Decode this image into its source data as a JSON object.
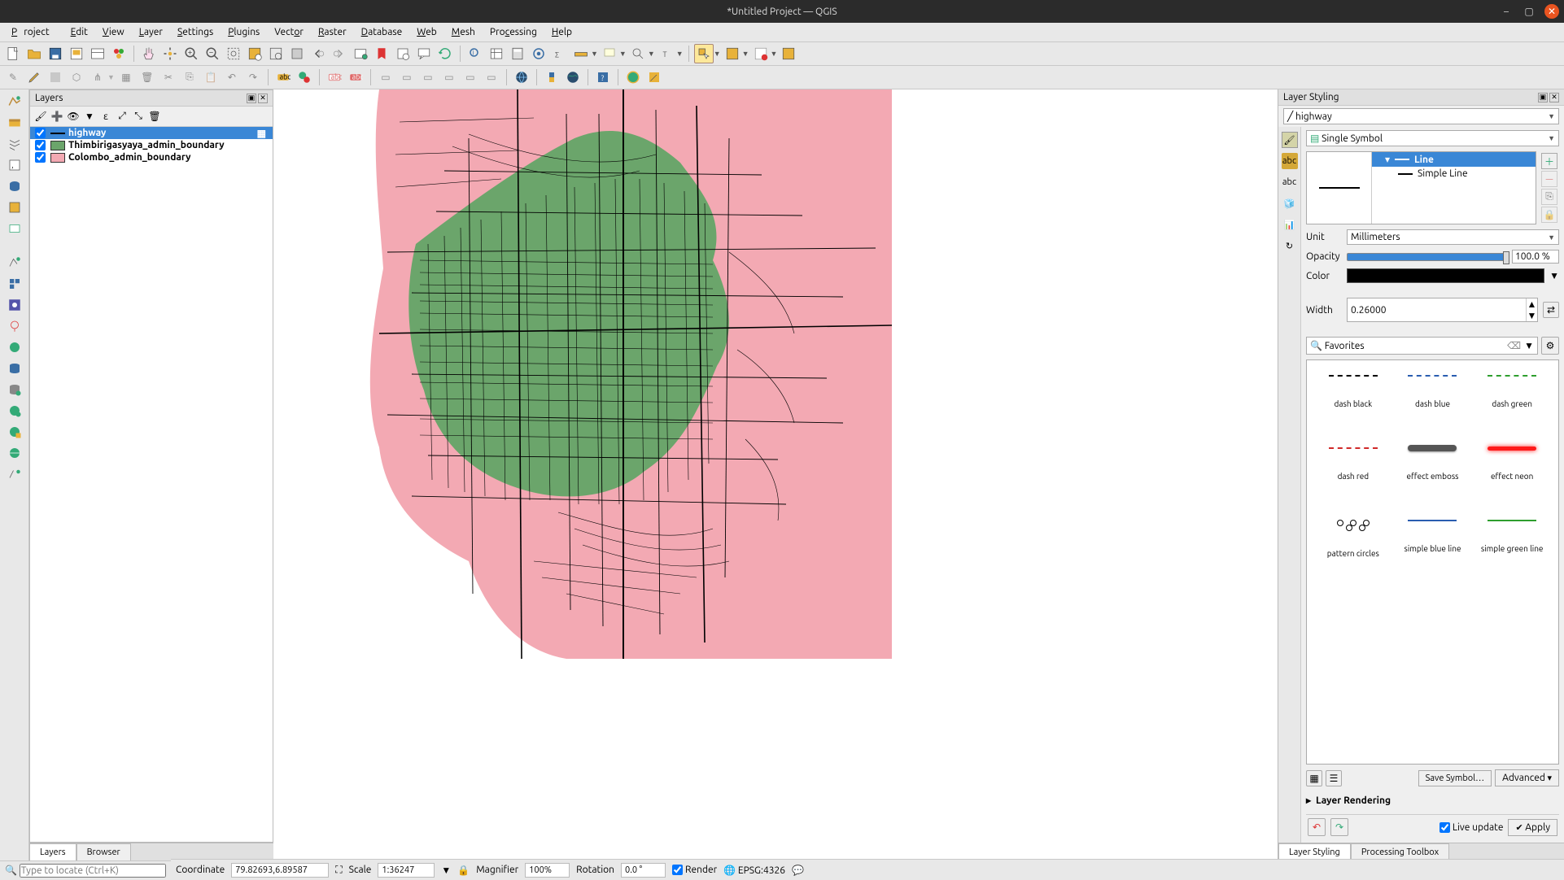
{
  "window": {
    "title": "*Untitled Project — QGIS"
  },
  "menu": [
    "Project",
    "Edit",
    "View",
    "Layer",
    "Settings",
    "Plugins",
    "Vector",
    "Raster",
    "Database",
    "Web",
    "Mesh",
    "Processing",
    "Help"
  ],
  "layers_panel": {
    "title": "Layers",
    "items": [
      {
        "name": "highway",
        "checked": true,
        "selected": true,
        "kind": "line"
      },
      {
        "name": "Thimbirigasyaya_admin_boundary",
        "checked": true,
        "color": "#6ba56b"
      },
      {
        "name": "Colombo_admin_boundary",
        "checked": true,
        "color": "#f3a9b3"
      }
    ],
    "tabs": {
      "layers": "Layers",
      "browser": "Browser"
    }
  },
  "locate_placeholder": "Type to locate (Ctrl+K)",
  "status": {
    "coord_label": "Coordinate",
    "coord": "79.82693,6.89587",
    "scale_label": "Scale",
    "scale": "1:36247",
    "mag_label": "Magnifier",
    "mag": "100%",
    "rot_label": "Rotation",
    "rot": "0.0 °",
    "render": "Render",
    "epsg": "EPSG:4326"
  },
  "styling": {
    "title": "Layer Styling",
    "layer": "highway",
    "renderer": "Single Symbol",
    "tree": {
      "line": "Line",
      "simple": "Simple Line"
    },
    "unit_label": "Unit",
    "unit": "Millimeters",
    "opacity_label": "Opacity",
    "opacity": "100.0 %",
    "color_label": "Color",
    "width_label": "Width",
    "width": "0.26000",
    "fav_label": "Favorites",
    "favorites": [
      {
        "name": "dash  black",
        "style": "dash",
        "color": "#000"
      },
      {
        "name": "dash blue",
        "style": "dash",
        "color": "#2a5db0"
      },
      {
        "name": "dash green",
        "style": "dash",
        "color": "#2e9e2e"
      },
      {
        "name": "dash red",
        "style": "dash",
        "color": "#d02a2a"
      },
      {
        "name": "effect emboss",
        "style": "emboss",
        "color": "#555"
      },
      {
        "name": "effect neon",
        "style": "neon",
        "color": "#ff1a1a"
      },
      {
        "name": "pattern circles",
        "style": "circles",
        "color": "#000"
      },
      {
        "name": "simple blue line",
        "style": "solid",
        "color": "#2a5db0"
      },
      {
        "name": "simple green line",
        "style": "solid",
        "color": "#2e9e2e"
      }
    ],
    "save_btn": "Save Symbol…",
    "adv_btn": "Advanced",
    "layer_rendering": "Layer Rendering",
    "live": "Live update",
    "apply": "Apply",
    "tabs": {
      "styling": "Layer Styling",
      "toolbox": "Processing Toolbox"
    }
  }
}
